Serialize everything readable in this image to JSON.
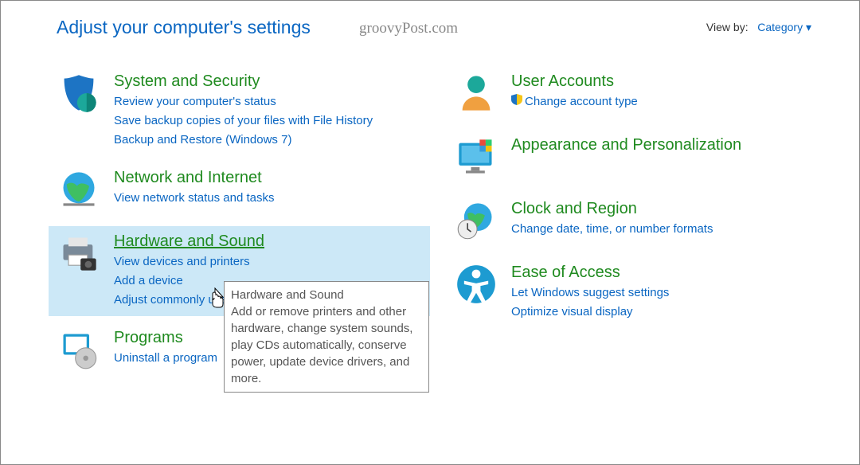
{
  "header": {
    "title": "Adjust your computer's settings",
    "watermark": "groovyPost.com",
    "view_by_label": "View by:",
    "view_by_value": "Category"
  },
  "left": [
    {
      "title": "System and Security",
      "links": [
        "Review your computer's status",
        "Save backup copies of your files with File History",
        "Backup and Restore (Windows 7)"
      ]
    },
    {
      "title": "Network and Internet",
      "links": [
        "View network status and tasks"
      ]
    },
    {
      "title": "Hardware and Sound",
      "links": [
        "View devices and printers",
        "Add a device",
        "Adjust commonly used mobility settings"
      ]
    },
    {
      "title": "Programs",
      "links": [
        "Uninstall a program"
      ]
    }
  ],
  "right": [
    {
      "title": "User Accounts",
      "links": [
        "Change account type"
      ],
      "shield": true
    },
    {
      "title": "Appearance and Personalization",
      "links": []
    },
    {
      "title": "Clock and Region",
      "links": [
        "Change date, time, or number formats"
      ]
    },
    {
      "title": "Ease of Access",
      "links": [
        "Let Windows suggest settings",
        "Optimize visual display"
      ]
    }
  ],
  "tooltip": {
    "title": "Hardware and Sound",
    "body": "Add or remove printers and other hardware, change system sounds, play CDs automatically, conserve power, update device drivers, and more."
  }
}
